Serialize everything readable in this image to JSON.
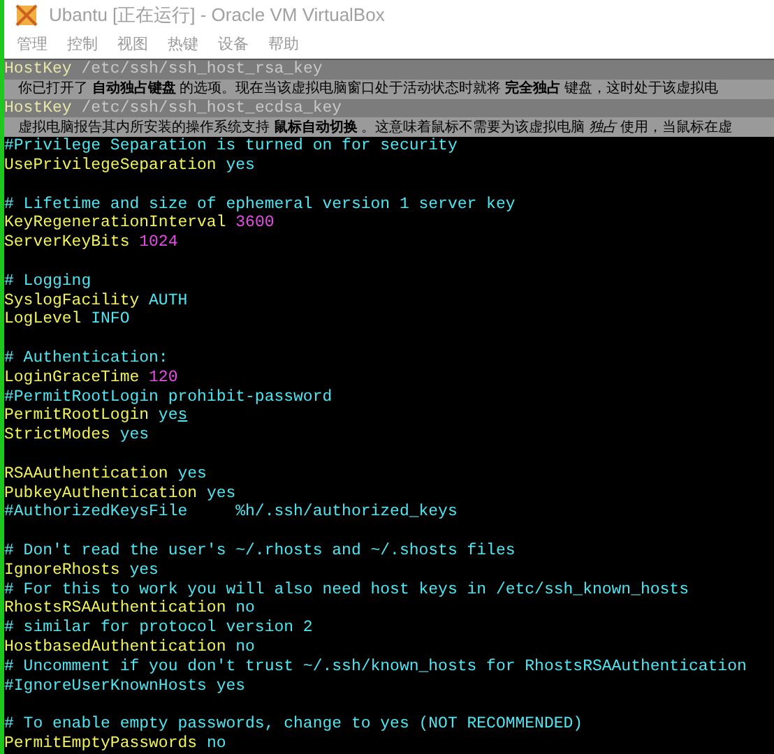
{
  "window": {
    "title": "Ubantu [正在运行] - Oracle VM VirtualBox"
  },
  "menu": [
    "管理",
    "控制",
    "视图",
    "热键",
    "设备",
    "帮助"
  ],
  "notification_overlay": {
    "rows": [
      {
        "kind": "terminal",
        "segments": [
          {
            "kind": "key",
            "text": "HostKey "
          },
          {
            "kind": "value",
            "text": "/etc/ssh/ssh_host_rsa_key"
          }
        ]
      },
      {
        "kind": "message",
        "text": "你已打开了 **自动独占键盘** 的选项。现在当该虚拟电脑窗口处于活动状态时就将 **完全独占** 键盘，这时处于该虚拟电"
      },
      {
        "kind": "terminal",
        "segments": [
          {
            "kind": "key",
            "text": "HostKey "
          },
          {
            "kind": "value",
            "text": "/etc/ssh/ssh_host_ecdsa_key"
          }
        ]
      },
      {
        "kind": "message",
        "text": "虚拟电脑报告其内所安装的操作系统支持 **鼠标自动切换** 。这意味着鼠标不需要为该虚拟电脑 *独占* 使用，当鼠标在虚"
      }
    ]
  },
  "terminal": {
    "lines": [
      {
        "kind": "text",
        "segments": [
          {
            "kind": "comment",
            "text": "#Privilege Separation is turned on for security"
          }
        ]
      },
      {
        "kind": "text",
        "segments": [
          {
            "kind": "key",
            "text": "UsePrivilegeSeparation "
          },
          {
            "kind": "value",
            "text": "yes"
          }
        ]
      },
      {
        "kind": "blank"
      },
      {
        "kind": "text",
        "segments": [
          {
            "kind": "comment",
            "text": "# Lifetime and size of ephemeral version 1 server key"
          }
        ]
      },
      {
        "kind": "text",
        "segments": [
          {
            "kind": "key",
            "text": "KeyRegenerationInterval "
          },
          {
            "kind": "number",
            "text": "3600"
          }
        ]
      },
      {
        "kind": "text",
        "segments": [
          {
            "kind": "key",
            "text": "ServerKeyBits "
          },
          {
            "kind": "number",
            "text": "1024"
          }
        ]
      },
      {
        "kind": "blank"
      },
      {
        "kind": "text",
        "segments": [
          {
            "kind": "comment",
            "text": "# Logging"
          }
        ]
      },
      {
        "kind": "text",
        "segments": [
          {
            "kind": "key",
            "text": "SyslogFacility "
          },
          {
            "kind": "value",
            "text": "AUTH"
          }
        ]
      },
      {
        "kind": "text",
        "segments": [
          {
            "kind": "key",
            "text": "LogLevel "
          },
          {
            "kind": "value",
            "text": "INFO"
          }
        ]
      },
      {
        "kind": "blank"
      },
      {
        "kind": "text",
        "segments": [
          {
            "kind": "comment",
            "text": "# Authentication:"
          }
        ]
      },
      {
        "kind": "text",
        "segments": [
          {
            "kind": "key",
            "text": "LoginGraceTime "
          },
          {
            "kind": "number",
            "text": "120"
          }
        ]
      },
      {
        "kind": "text",
        "segments": [
          {
            "kind": "comment",
            "text": "#PermitRootLogin prohibit-password"
          }
        ]
      },
      {
        "kind": "text",
        "segments": [
          {
            "kind": "key",
            "text": "PermitRootLogin "
          },
          {
            "kind": "value",
            "text": "ye"
          },
          {
            "kind": "cursor",
            "text": "s"
          }
        ]
      },
      {
        "kind": "text",
        "segments": [
          {
            "kind": "key",
            "text": "StrictModes "
          },
          {
            "kind": "value",
            "text": "yes"
          }
        ]
      },
      {
        "kind": "blank"
      },
      {
        "kind": "text",
        "segments": [
          {
            "kind": "key",
            "text": "RSAAuthentication "
          },
          {
            "kind": "value",
            "text": "yes"
          }
        ]
      },
      {
        "kind": "text",
        "segments": [
          {
            "kind": "key",
            "text": "PubkeyAuthentication "
          },
          {
            "kind": "value",
            "text": "yes"
          }
        ]
      },
      {
        "kind": "text",
        "segments": [
          {
            "kind": "comment",
            "text": "#AuthorizedKeysFile     %h/.ssh/authorized_keys"
          }
        ]
      },
      {
        "kind": "blank"
      },
      {
        "kind": "text",
        "segments": [
          {
            "kind": "comment",
            "text": "# Don't read the user's ~/.rhosts and ~/.shosts files"
          }
        ]
      },
      {
        "kind": "text",
        "segments": [
          {
            "kind": "key",
            "text": "IgnoreRhosts "
          },
          {
            "kind": "value",
            "text": "yes"
          }
        ]
      },
      {
        "kind": "text",
        "segments": [
          {
            "kind": "comment",
            "text": "# For this to work you will also need host keys in /etc/ssh_known_hosts"
          }
        ]
      },
      {
        "kind": "text",
        "segments": [
          {
            "kind": "key",
            "text": "RhostsRSAAuthentication "
          },
          {
            "kind": "value",
            "text": "no"
          }
        ]
      },
      {
        "kind": "text",
        "segments": [
          {
            "kind": "comment",
            "text": "# similar for protocol version 2"
          }
        ]
      },
      {
        "kind": "text",
        "segments": [
          {
            "kind": "key",
            "text": "HostbasedAuthentication "
          },
          {
            "kind": "value",
            "text": "no"
          }
        ]
      },
      {
        "kind": "text",
        "segments": [
          {
            "kind": "comment",
            "text": "# Uncomment if you don't trust ~/.ssh/known_hosts for RhostsRSAAuthentication"
          }
        ]
      },
      {
        "kind": "text",
        "segments": [
          {
            "kind": "comment",
            "text": "#IgnoreUserKnownHosts yes"
          }
        ]
      },
      {
        "kind": "blank"
      },
      {
        "kind": "text",
        "segments": [
          {
            "kind": "comment",
            "text": "# To enable empty passwords, change to yes (NOT RECOMMENDED)"
          }
        ]
      },
      {
        "kind": "text",
        "segments": [
          {
            "kind": "key",
            "text": "PermitEmptyPasswords "
          },
          {
            "kind": "value",
            "text": "no"
          }
        ]
      }
    ]
  }
}
